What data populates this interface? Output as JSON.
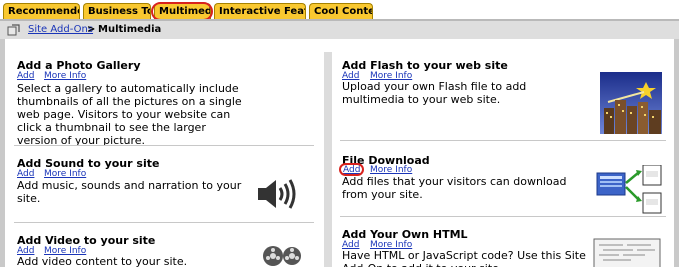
{
  "tabs": [
    {
      "label": "Recommended"
    },
    {
      "label": "Business Tools"
    },
    {
      "label": "Multimedia"
    },
    {
      "label": "Interactive Features"
    },
    {
      "label": "Cool Content"
    }
  ],
  "breadcrumb": {
    "root": "Site Add-Ons",
    "separator": ">",
    "current": "Multimedia"
  },
  "links": {
    "add": "Add",
    "more_info": "More Info"
  },
  "left_items": [
    {
      "title": "Add a Photo Gallery",
      "desc": "Select a gallery to automatically include thumbnails of all the pictures on a single web page. Visitors to your website can click a thumbnail to see the larger version of your picture.",
      "icon": "photo-gallery-icon"
    },
    {
      "title": "Add Sound to your site",
      "desc": "Add music, sounds and narration to your site.",
      "icon": "speaker-icon"
    },
    {
      "title": "Add Video to your site",
      "desc": "Add video content to your site.",
      "icon": "film-reel-icon"
    }
  ],
  "right_items": [
    {
      "title": "Add Flash to your web site",
      "desc": "Upload your own Flash file to add multimedia to your web site.",
      "icon": "flash-city-icon"
    },
    {
      "title": "File Download",
      "desc": "Add files that your visitors can download from your site.",
      "icon": "file-download-icon"
    },
    {
      "title": "Add Your Own HTML",
      "desc": "Have HTML or JavaScript code? Use this Site Add-On to add it to your site.",
      "icon": "html-code-icon"
    }
  ],
  "colors": {
    "tab": "#f9c830",
    "link": "#1a35b8",
    "highlight": "#d8231e"
  }
}
